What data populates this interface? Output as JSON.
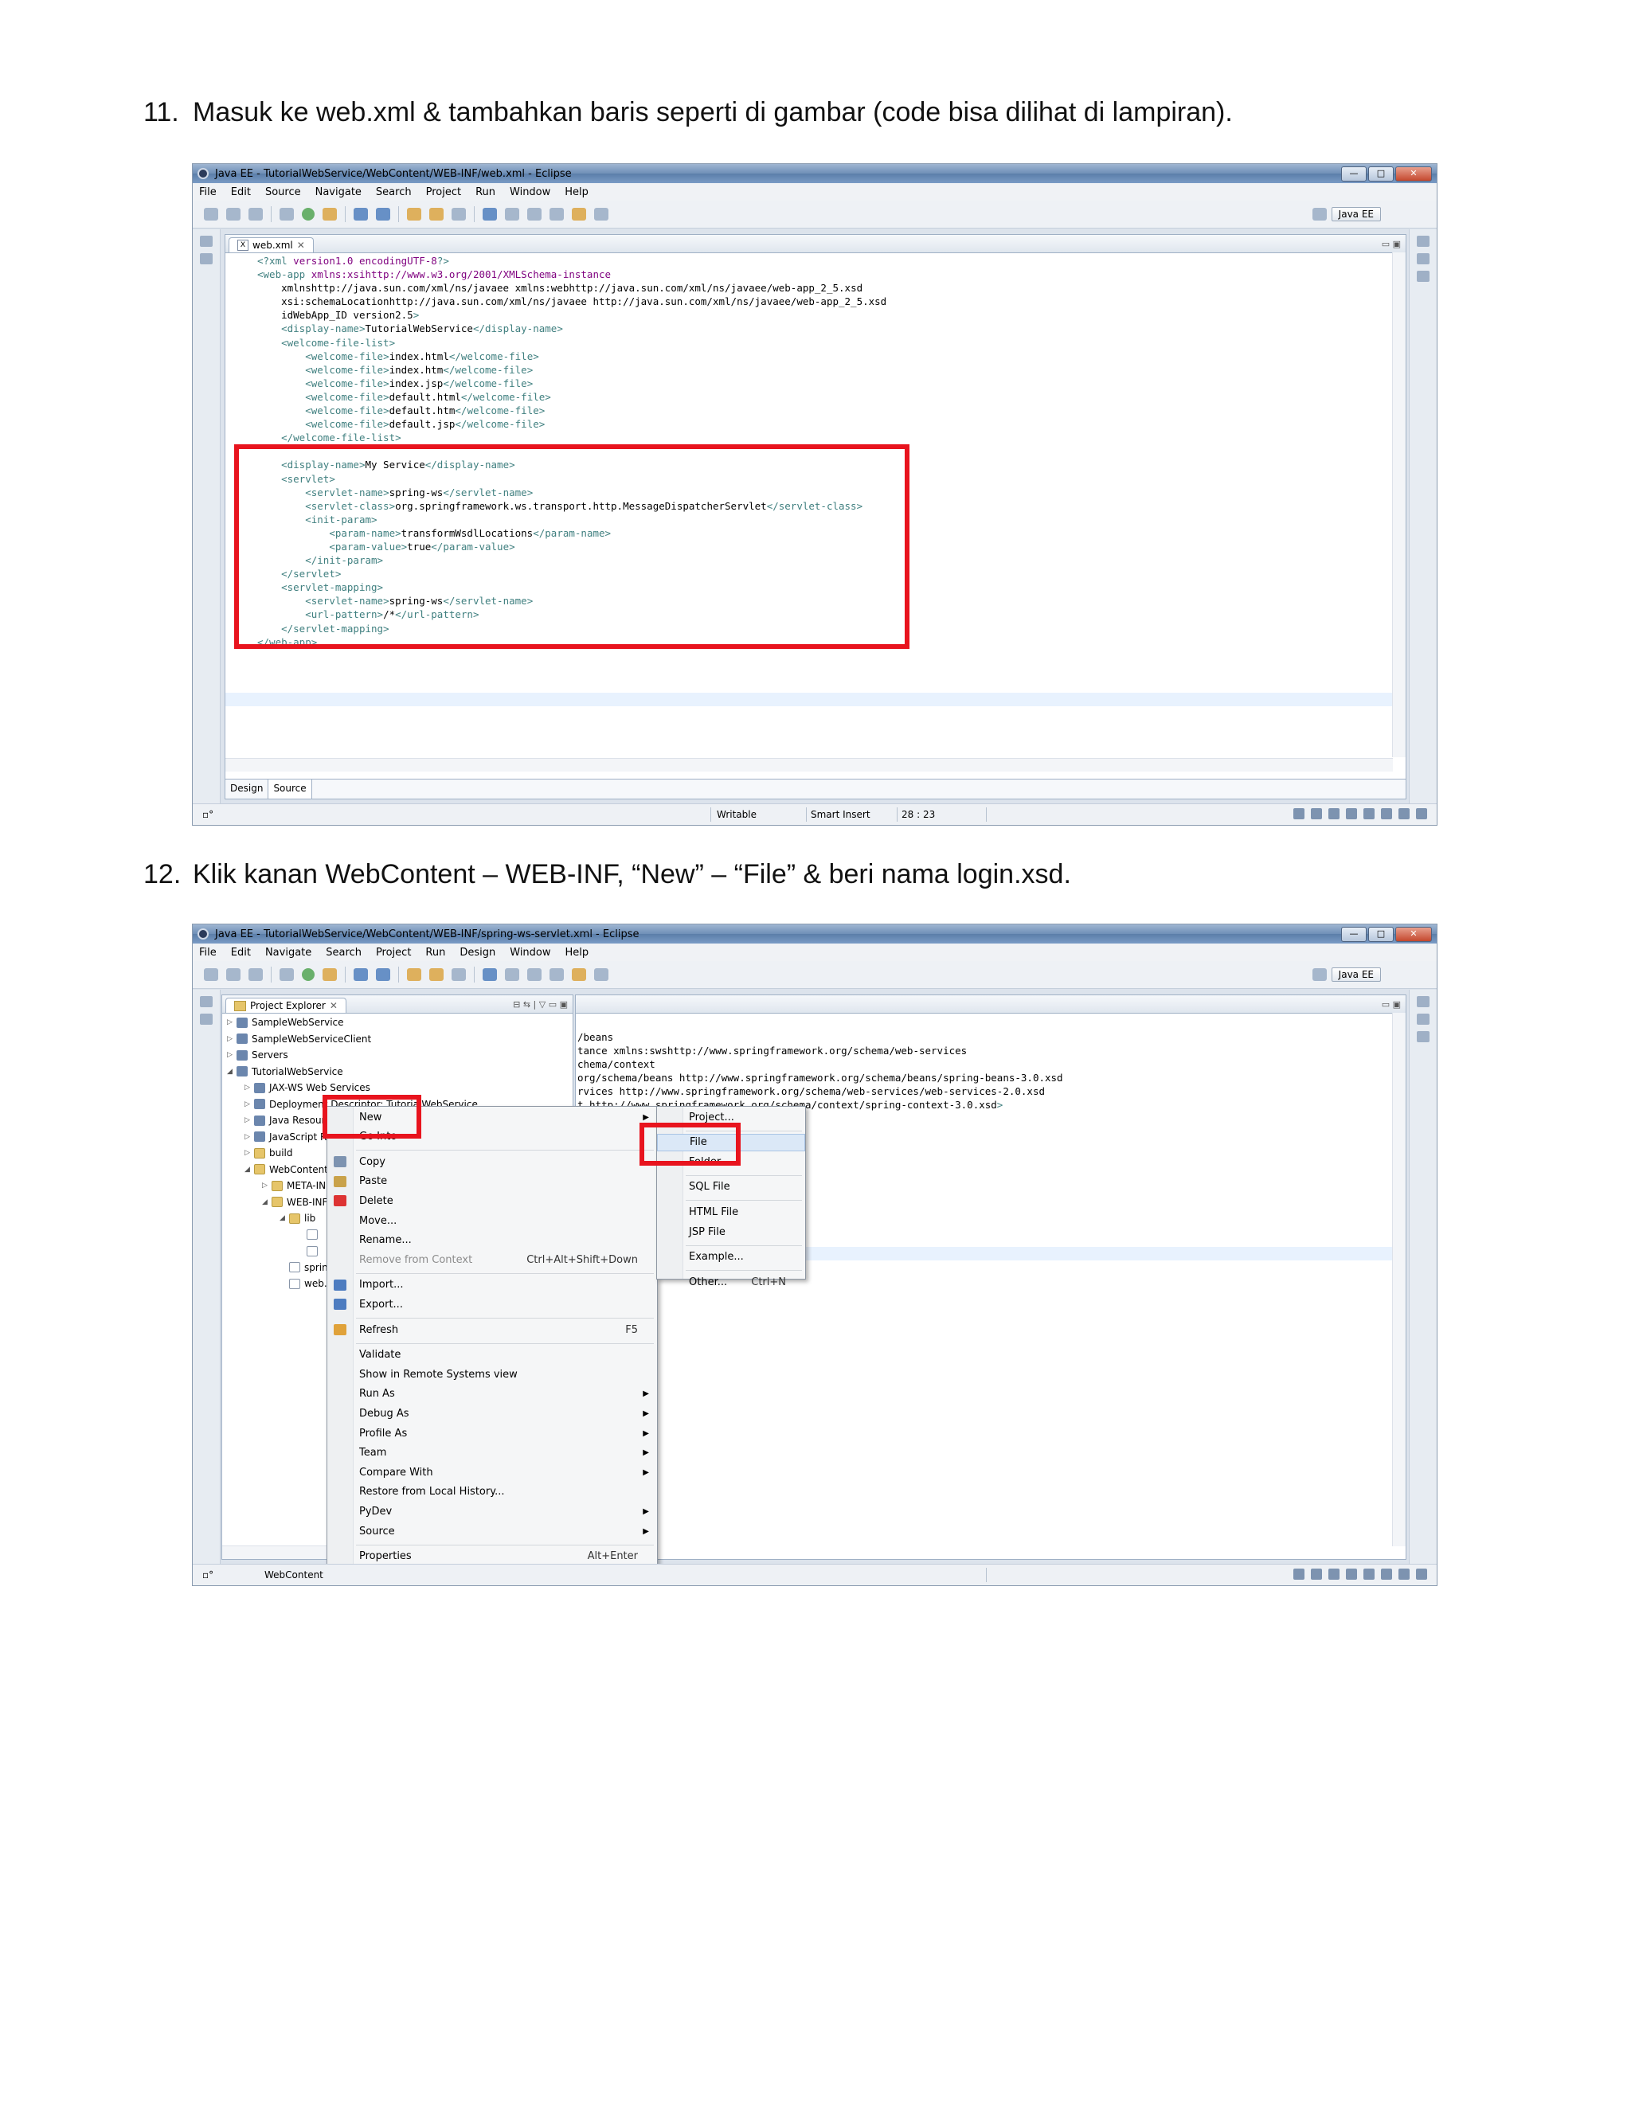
{
  "step11": {
    "number": "11.",
    "text": "Masuk ke web.xml & tambahkan baris seperti di gambar (code bisa dilihat di lampiran)."
  },
  "step12": {
    "number": "12.",
    "text": "Klik kanan WebContent – WEB-INF, “New” – “File” & beri nama login.xsd."
  },
  "window1": {
    "title": "Java EE - TutorialWebService/WebContent/WEB-INF/web.xml - Eclipse",
    "menu": [
      "File",
      "Edit",
      "Source",
      "Navigate",
      "Search",
      "Project",
      "Run",
      "Window",
      "Help"
    ],
    "perspective": "Java EE",
    "editor_tab": "web.xml",
    "bottom_tabs": [
      "Design",
      "Source"
    ],
    "status": {
      "mode": "Writable",
      "insert": "Smart Insert",
      "position": "28 : 23"
    },
    "code_lines": [
      "<?xml version=\"1.0\" encoding=\"UTF-8\"?>",
      "<web-app xmlns:xsi=\"http://www.w3.org/2001/XMLSchema-instance\"",
      "    xmlns=\"http://java.sun.com/xml/ns/javaee\" xmlns:web=\"http://java.sun.com/xml/ns/javaee/web-app_2_5.xsd\"",
      "    xsi:schemaLocation=\"http://java.sun.com/xml/ns/javaee http://java.sun.com/xml/ns/javaee/web-app_2_5.xsd\"",
      "    id=\"WebApp_ID\" version=\"2.5\">",
      "    <display-name>TutorialWebService</display-name>",
      "    <welcome-file-list>",
      "        <welcome-file>index.html</welcome-file>",
      "        <welcome-file>index.htm</welcome-file>",
      "        <welcome-file>index.jsp</welcome-file>",
      "        <welcome-file>default.html</welcome-file>",
      "        <welcome-file>default.htm</welcome-file>",
      "        <welcome-file>default.jsp</welcome-file>",
      "    </welcome-file-list>",
      "",
      "    <display-name>My Service</display-name>",
      "    <servlet>",
      "        <servlet-name>spring-ws</servlet-name>",
      "        <servlet-class>org.springframework.ws.transport.http.MessageDispatcherServlet</servlet-class>",
      "        <init-param>",
      "            <param-name>transformWsdlLocations</param-name>",
      "            <param-value>true</param-value>",
      "        </init-param>",
      "    </servlet>",
      "    <servlet-mapping>",
      "        <servlet-name>spring-ws</servlet-name>",
      "        <url-pattern>/*</url-pattern>",
      "    </servlet-mapping>",
      "</web-app>"
    ]
  },
  "window2": {
    "title": "Java EE - TutorialWebService/WebContent/WEB-INF/spring-ws-servlet.xml - Eclipse",
    "menu": [
      "File",
      "Edit",
      "Navigate",
      "Search",
      "Project",
      "Run",
      "Design",
      "Window",
      "Help"
    ],
    "perspective": "Java EE",
    "explorer_title": "Project Explorer",
    "tree": [
      {
        "label": "SampleWebService",
        "indent": 0,
        "arrow": "▷"
      },
      {
        "label": "SampleWebServiceClient",
        "indent": 0,
        "arrow": "▷"
      },
      {
        "label": "Servers",
        "indent": 0,
        "arrow": "▷"
      },
      {
        "label": "TutorialWebService",
        "indent": 0,
        "arrow": "◢"
      },
      {
        "label": "JAX-WS Web Services",
        "indent": 1,
        "arrow": "▷"
      },
      {
        "label": "Deployment Descriptor: TutorialWebService",
        "indent": 1,
        "arrow": "▷"
      },
      {
        "label": "Java Resources",
        "indent": 1,
        "arrow": "▷"
      },
      {
        "label": "JavaScript Resources",
        "indent": 1,
        "arrow": "▷"
      },
      {
        "label": "build",
        "indent": 1,
        "arrow": "▷"
      },
      {
        "label": "WebContent",
        "indent": 1,
        "arrow": "◢"
      },
      {
        "label": "META-INF",
        "indent": 2,
        "arrow": "▷"
      },
      {
        "label": "WEB-INF",
        "indent": 2,
        "arrow": "◢"
      },
      {
        "label": "lib",
        "indent": 3,
        "arrow": "◢"
      },
      {
        "label": "",
        "indent": 4,
        "arrow": ""
      },
      {
        "label": "",
        "indent": 4,
        "arrow": ""
      },
      {
        "label": "spring-ws-servlet.xml",
        "indent": 3,
        "arrow": ""
      },
      {
        "label": "web.xml",
        "indent": 3,
        "arrow": ""
      }
    ],
    "code_fragments": [
      "/beans\"",
      "tance\" xmlns:sws=\"http://www.springframework.org/schema/web-services\"",
      "chema/context\"",
      "org/schema/beans http://www.springframework.org/schema/beans/spring-beans-3.0.xsd",
      "rvices http://www.springframework.org/schema/web-services/web-services-2.0.xsd",
      "t http://www.springframework.org/schema/context/spring-context-3.0.xsd\">"
    ],
    "context_menu": [
      {
        "label": "New",
        "key": "",
        "sub": true,
        "icon": ""
      },
      {
        "label": "Go Into",
        "key": "",
        "sub": false,
        "icon": ""
      },
      {
        "sep": true
      },
      {
        "label": "Copy",
        "key": "",
        "sub": false,
        "icon": "copy"
      },
      {
        "label": "Paste",
        "key": "",
        "sub": false,
        "icon": "paste"
      },
      {
        "label": "Delete",
        "key": "",
        "sub": false,
        "icon": "delete"
      },
      {
        "label": "Move...",
        "key": "",
        "sub": false,
        "icon": ""
      },
      {
        "label": "Rename...",
        "key": "",
        "sub": false,
        "icon": ""
      },
      {
        "label": "Remove from Context",
        "key": "Ctrl+Alt+Shift+Down",
        "sub": false,
        "icon": "",
        "disabled": true
      },
      {
        "sep": true
      },
      {
        "label": "Import...",
        "key": "",
        "sub": false,
        "icon": "import"
      },
      {
        "label": "Export...",
        "key": "",
        "sub": false,
        "icon": "export"
      },
      {
        "sep": true
      },
      {
        "label": "Refresh",
        "key": "F5",
        "sub": false,
        "icon": "refresh"
      },
      {
        "sep": true
      },
      {
        "label": "Validate",
        "key": "",
        "sub": false,
        "icon": ""
      },
      {
        "label": "Show in Remote Systems view",
        "key": "",
        "sub": false,
        "icon": ""
      },
      {
        "label": "Run As",
        "key": "",
        "sub": true,
        "icon": ""
      },
      {
        "label": "Debug As",
        "key": "",
        "sub": true,
        "icon": ""
      },
      {
        "label": "Profile As",
        "key": "",
        "sub": true,
        "icon": ""
      },
      {
        "label": "Team",
        "key": "",
        "sub": true,
        "icon": ""
      },
      {
        "label": "Compare With",
        "key": "",
        "sub": true,
        "icon": ""
      },
      {
        "label": "Restore from Local History...",
        "key": "",
        "sub": false,
        "icon": ""
      },
      {
        "label": "PyDev",
        "key": "",
        "sub": true,
        "icon": ""
      },
      {
        "label": "Source",
        "key": "",
        "sub": true,
        "icon": ""
      },
      {
        "sep": true
      },
      {
        "label": "Properties",
        "key": "Alt+Enter",
        "sub": false,
        "icon": ""
      }
    ],
    "submenu": [
      {
        "label": "Project...",
        "key": ""
      },
      {
        "sep": true
      },
      {
        "label": "File",
        "key": "",
        "hl": true
      },
      {
        "label": "Folder",
        "key": ""
      },
      {
        "sep": true
      },
      {
        "label": "SQL File",
        "key": ""
      },
      {
        "sep": true
      },
      {
        "label": "HTML File",
        "key": ""
      },
      {
        "label": "JSP File",
        "key": ""
      },
      {
        "sep": true
      },
      {
        "label": "Example...",
        "key": ""
      },
      {
        "sep": true
      },
      {
        "label": "Other...",
        "key": "Ctrl+N"
      }
    ],
    "status_item": "WebContent"
  },
  "colors": {
    "highlight_red": "#e8141e",
    "xml_tag": "#3f7f7f",
    "xml_attr": "#7f007f",
    "xml_value": "#2a00ff"
  }
}
